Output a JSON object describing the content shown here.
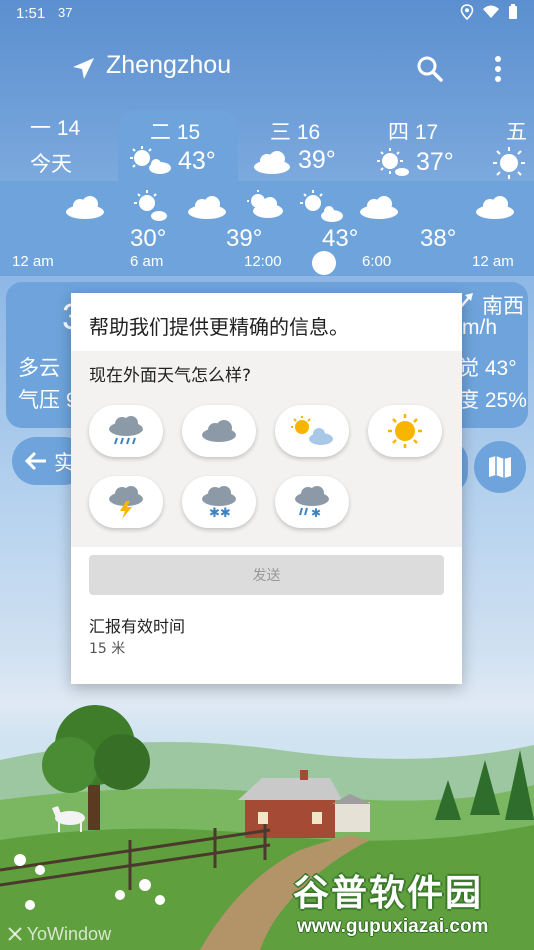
{
  "status_bar": {
    "time": "1:51",
    "network_badge": "37",
    "icons": [
      "location-icon",
      "wifi-icon",
      "battery-icon"
    ]
  },
  "header": {
    "city": "Zhengzhou",
    "icons": [
      "navigation-arrow-icon",
      "search-icon",
      "more-vert-icon"
    ]
  },
  "days": [
    {
      "weekday": "一 14",
      "label": "今天",
      "temp": ""
    },
    {
      "weekday": "二 15",
      "label": "",
      "temp": "43°"
    },
    {
      "weekday": "三 16",
      "label": "",
      "temp": "39°"
    },
    {
      "weekday": "四 17",
      "label": "",
      "temp": "37°"
    },
    {
      "weekday": "五",
      "label": "",
      "temp": ""
    }
  ],
  "hourly": {
    "temps": [
      "30°",
      "39°",
      "43°",
      "38°"
    ],
    "hours": [
      "12 am",
      "6 am",
      "12:00",
      "6:00",
      "12 am"
    ]
  },
  "current": {
    "big": "3",
    "wind_dir": "南西",
    "wind_unit": "m/h",
    "condition": "多云",
    "pressure": "气压 9",
    "feels": "觉 43°",
    "humidity": "度 25%"
  },
  "actual_button": {
    "label": "实"
  },
  "dialog": {
    "title": "帮助我们提供更精确的信息。",
    "question": "现在外面天气怎么样?",
    "options": [
      "rain-icon",
      "cloud-icon",
      "partly-cloudy-icon",
      "sun-icon",
      "thunderstorm-icon",
      "snow-icon",
      "sleet-icon"
    ],
    "send_label": "发送",
    "accuracy_label": "汇报有效时间",
    "accuracy_value": "15 米"
  },
  "footer": {
    "credit": "YoWindow"
  },
  "watermark": {
    "logo": "谷普软件园",
    "url": "www.gupuxiazai.com"
  },
  "colors": {
    "panel": "#6ea4db",
    "sun": "#f7b500"
  }
}
